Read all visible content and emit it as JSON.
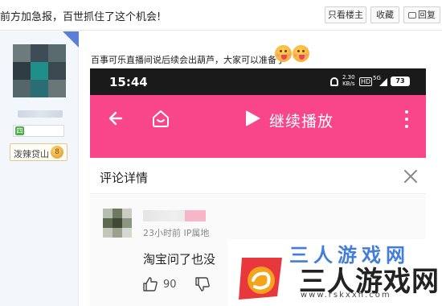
{
  "topbar": {
    "thread_title": "前方加急报，百世抓住了这个机会!",
    "louzhu_label": "只看楼主",
    "collect_label": "收藏",
    "reply_label": "回复"
  },
  "sidebar": {
    "honor_label": "泼辣贷山",
    "honor_level": "8",
    "level_icon": "四"
  },
  "post": {
    "text": "百事可乐直播间说后续会出葫芦，大家可以准备了"
  },
  "phone": {
    "status": {
      "time": "15:44",
      "speed_value": "2.30",
      "speed_unit": "KB/s",
      "hd": "HD",
      "network": "5G",
      "battery": "73"
    },
    "header": {
      "continue_label": "继续播放"
    },
    "comment_title": "评论详情",
    "comment": {
      "meta": "23小时前  IP属地",
      "text": "淘宝问了也没",
      "likes": "90"
    }
  },
  "watermark": {
    "main": "三人游戏网",
    "url": "www.rskxxh.com",
    "top": "三人游戏网"
  },
  "colors": {
    "pink": "#f9468a",
    "status_bar": "#1a1a1a",
    "sidebar_bg": "#f3f6fa",
    "accent_blue": "#5b7fd6"
  },
  "icons": [
    "reply-icon",
    "back-arrow-icon",
    "home-icon",
    "play-icon",
    "more-icon",
    "close-icon",
    "thumb-up-icon",
    "thumb-down-icon",
    "mute-icon",
    "signal-icon",
    "battery-icon",
    "emoji-icon"
  ]
}
